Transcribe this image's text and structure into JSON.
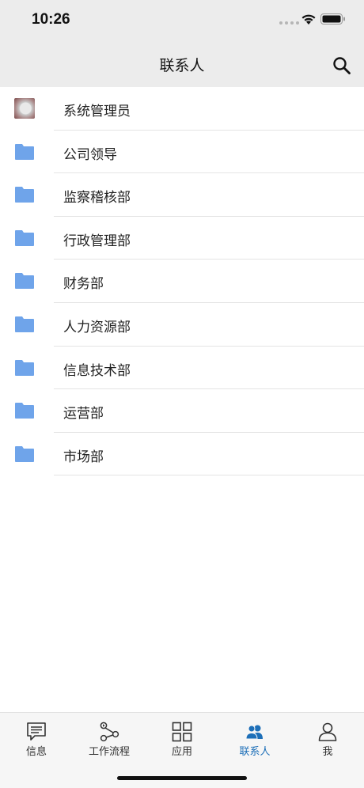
{
  "status_bar": {
    "time": "10:26"
  },
  "nav": {
    "title": "联系人",
    "search_icon": "search-icon"
  },
  "contacts": [
    {
      "label": "系统管理员",
      "icon": "avatar"
    },
    {
      "label": "公司领导",
      "icon": "folder-icon"
    },
    {
      "label": "监察稽核部",
      "icon": "folder-icon"
    },
    {
      "label": "行政管理部",
      "icon": "folder-icon"
    },
    {
      "label": "财务部",
      "icon": "folder-icon"
    },
    {
      "label": "人力资源部",
      "icon": "folder-icon"
    },
    {
      "label": "信息技术部",
      "icon": "folder-icon"
    },
    {
      "label": "运营部",
      "icon": "folder-icon"
    },
    {
      "label": "市场部",
      "icon": "folder-icon"
    }
  ],
  "tabs": [
    {
      "label": "信息",
      "icon": "message-icon"
    },
    {
      "label": "工作流程",
      "icon": "workflow-icon"
    },
    {
      "label": "应用",
      "icon": "apps-grid-icon"
    },
    {
      "label": "联系人",
      "icon": "contacts-icon",
      "active": true
    },
    {
      "label": "我",
      "icon": "profile-icon"
    }
  ],
  "colors": {
    "folder": "#6fa4ea",
    "active_tab": "#1d6fb8",
    "bar_background": "#ececec"
  }
}
